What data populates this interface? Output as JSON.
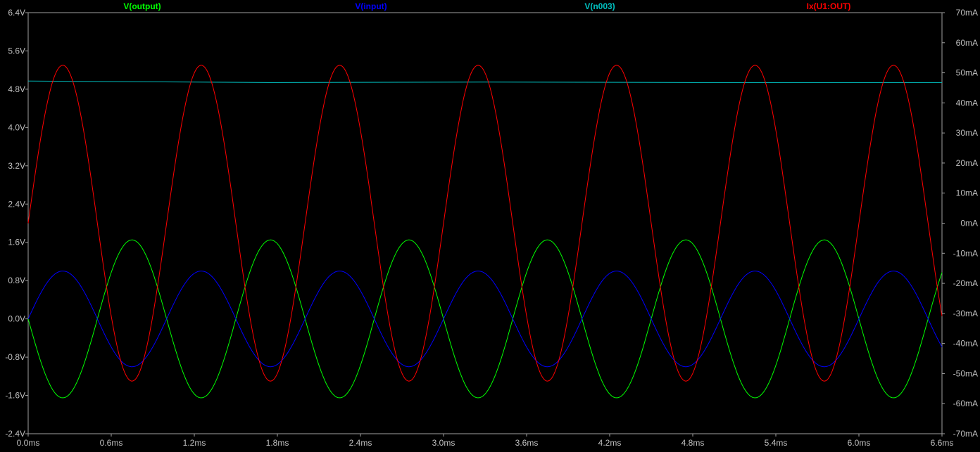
{
  "chart_data": {
    "type": "line",
    "x_axis": {
      "unit": "ms",
      "range": [
        0.0,
        6.6
      ],
      "ticks": [
        "0.0ms",
        "0.6ms",
        "1.2ms",
        "1.8ms",
        "2.4ms",
        "3.0ms",
        "3.6ms",
        "4.2ms",
        "4.8ms",
        "5.4ms",
        "6.0ms",
        "6.6ms"
      ]
    },
    "y_left": {
      "unit": "V",
      "range": [
        -2.4,
        6.4
      ],
      "ticks": [
        "6.4V",
        "5.6V",
        "4.8V",
        "4.0V",
        "3.2V",
        "2.4V",
        "1.6V",
        "0.8V",
        "0.0V",
        "-0.8V",
        "-1.6V",
        "-2.4V"
      ]
    },
    "y_right": {
      "unit": "mA",
      "range": [
        -70,
        70
      ],
      "ticks": [
        "70mA",
        "60mA",
        "50mA",
        "40mA",
        "30mA",
        "20mA",
        "10mA",
        "0mA",
        "-10mA",
        "-20mA",
        "-30mA",
        "-40mA",
        "-50mA",
        "-60mA",
        "-70mA"
      ]
    },
    "grid": false,
    "background": "#000000",
    "frame_color": "#a0a0a0",
    "series": [
      {
        "name": "V(output)",
        "color": "#00ff00",
        "axis": "left",
        "kind": "sine",
        "amplitude": 1.65,
        "offset": 0.0,
        "period_ms": 1.0,
        "phase_deg": 180
      },
      {
        "name": "V(input)",
        "color": "#0000ff",
        "axis": "left",
        "kind": "sine",
        "amplitude": 1.0,
        "offset": 0.0,
        "period_ms": 1.0,
        "phase_deg": 0
      },
      {
        "name": "V(n003)",
        "color": "#00c0c0",
        "axis": "left",
        "kind": "flat",
        "values": [
          [
            0.0,
            4.97
          ],
          [
            1.8,
            4.94
          ],
          [
            3.3,
            4.95
          ],
          [
            4.8,
            4.94
          ],
          [
            6.6,
            4.94
          ]
        ]
      },
      {
        "name": "Ix(U1:OUT)",
        "color": "#ff0000",
        "axis": "right",
        "kind": "sine",
        "amplitude": 52.5,
        "offset": 0.0,
        "period_ms": 1.0,
        "phase_deg": 0,
        "start_value": 0.0
      }
    ]
  }
}
